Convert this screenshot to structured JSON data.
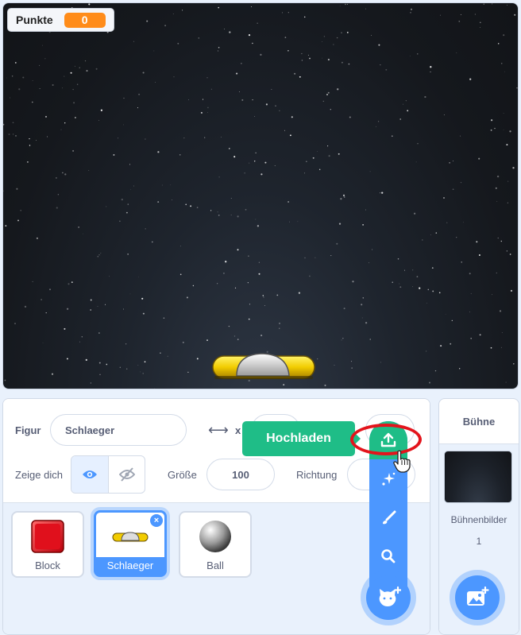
{
  "stage": {
    "monitor": {
      "label": "Punkte",
      "value": "0"
    }
  },
  "sprite_info": {
    "sprite_label": "Figur",
    "sprite_name": "Schlaeger",
    "x_label": "x",
    "show_label": "Zeige dich",
    "size_label": "Größe",
    "size_value": "100",
    "direction_label": "Richtung"
  },
  "sprites": [
    {
      "name": "Block",
      "selected": false
    },
    {
      "name": "Schlaeger",
      "selected": true
    },
    {
      "name": "Ball",
      "selected": false
    }
  ],
  "upload_menu": {
    "tooltip": "Hochladen",
    "items": [
      "upload-icon",
      "surprise-icon",
      "paint-icon",
      "search-icon"
    ],
    "main_icon": "cat-plus-icon"
  },
  "stage_panel": {
    "title": "Bühne",
    "backdrops_label": "Bühnenbilder",
    "backdrops_count": "1",
    "add_icon": "backdrop-add-icon"
  },
  "colors": {
    "accent": "#4c97ff",
    "upload_green": "#1fbd87",
    "monitor_orange": "#ff8c1a",
    "highlight_red": "#e3141c"
  }
}
